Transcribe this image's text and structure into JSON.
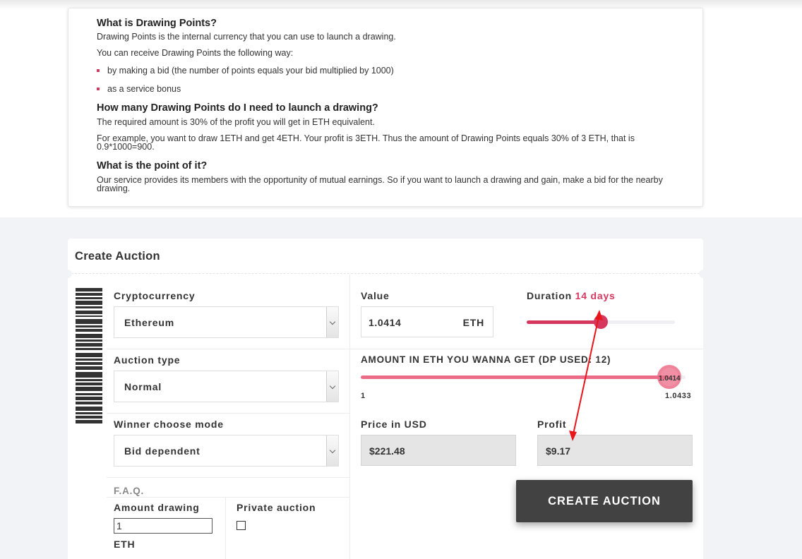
{
  "faq": {
    "q1": "What is Drawing Points?",
    "a1_line1": "Drawing Points is the internal currency that you can use to launch a drawing.",
    "a1_line2": "You can receive Drawing Points the following way:",
    "a1_bullets": [
      "by making a bid (the number of points equals your bid multiplied by 1000)",
      "as a service bonus"
    ],
    "q2": "How many Drawing Points do I need to launch a drawing?",
    "a2_line1": "The required amount is 30% of the profit you will get in ETH equivalent.",
    "a2_line2": "For example, you want to draw 1ETH and get 4ETH. Your profit is 3ETH. Thus the amount of Drawing Points equals 30% of 3 ETH, that is 0.9*1000=900.",
    "q3": "What is the point of it?",
    "a3_line1": "Our service provides its members with the opportunity of mutual earnings. So if you want to launch a drawing and gain, make a bid for the nearby drawing."
  },
  "auction": {
    "title": "Create Auction",
    "cryptocurrency_label": "Cryptocurrency",
    "cryptocurrency_value": "Ethereum",
    "auction_type_label": "Auction type",
    "auction_type_value": "Normal",
    "winner_mode_label": "Winner choose mode",
    "winner_mode_value": "Bid dependent",
    "faq_link": "F.A.Q.",
    "amount_drawing_label": "Amount drawing",
    "amount_drawing_value": "1",
    "amount_unit": "ETH",
    "private_auction_label": "Private auction",
    "private_auction_checked": false,
    "value_label": "Value",
    "value_amount": "1.0414",
    "value_unit": "ETH",
    "duration_label": "Duration",
    "duration_value": "14 days",
    "duration_fraction": 0.5,
    "amount_get_label": "AMOUNT IN ETH YOU WANNA GET (DP USED: 12)",
    "amount_get_min": "1",
    "amount_get_max": "1.0433",
    "amount_get_current": "1.0414",
    "amount_get_fraction": 0.95,
    "price_usd_label": "Price in USD",
    "price_usd_value": "$221.48",
    "profit_label": "Profit",
    "profit_value": "$9.17",
    "create_button": "CREATE AUCTION"
  },
  "colors": {
    "accent": "#d6375f",
    "accent_light": "#ec6b86",
    "annotation_arrow": "#e8161b",
    "button_bg": "#424242"
  }
}
